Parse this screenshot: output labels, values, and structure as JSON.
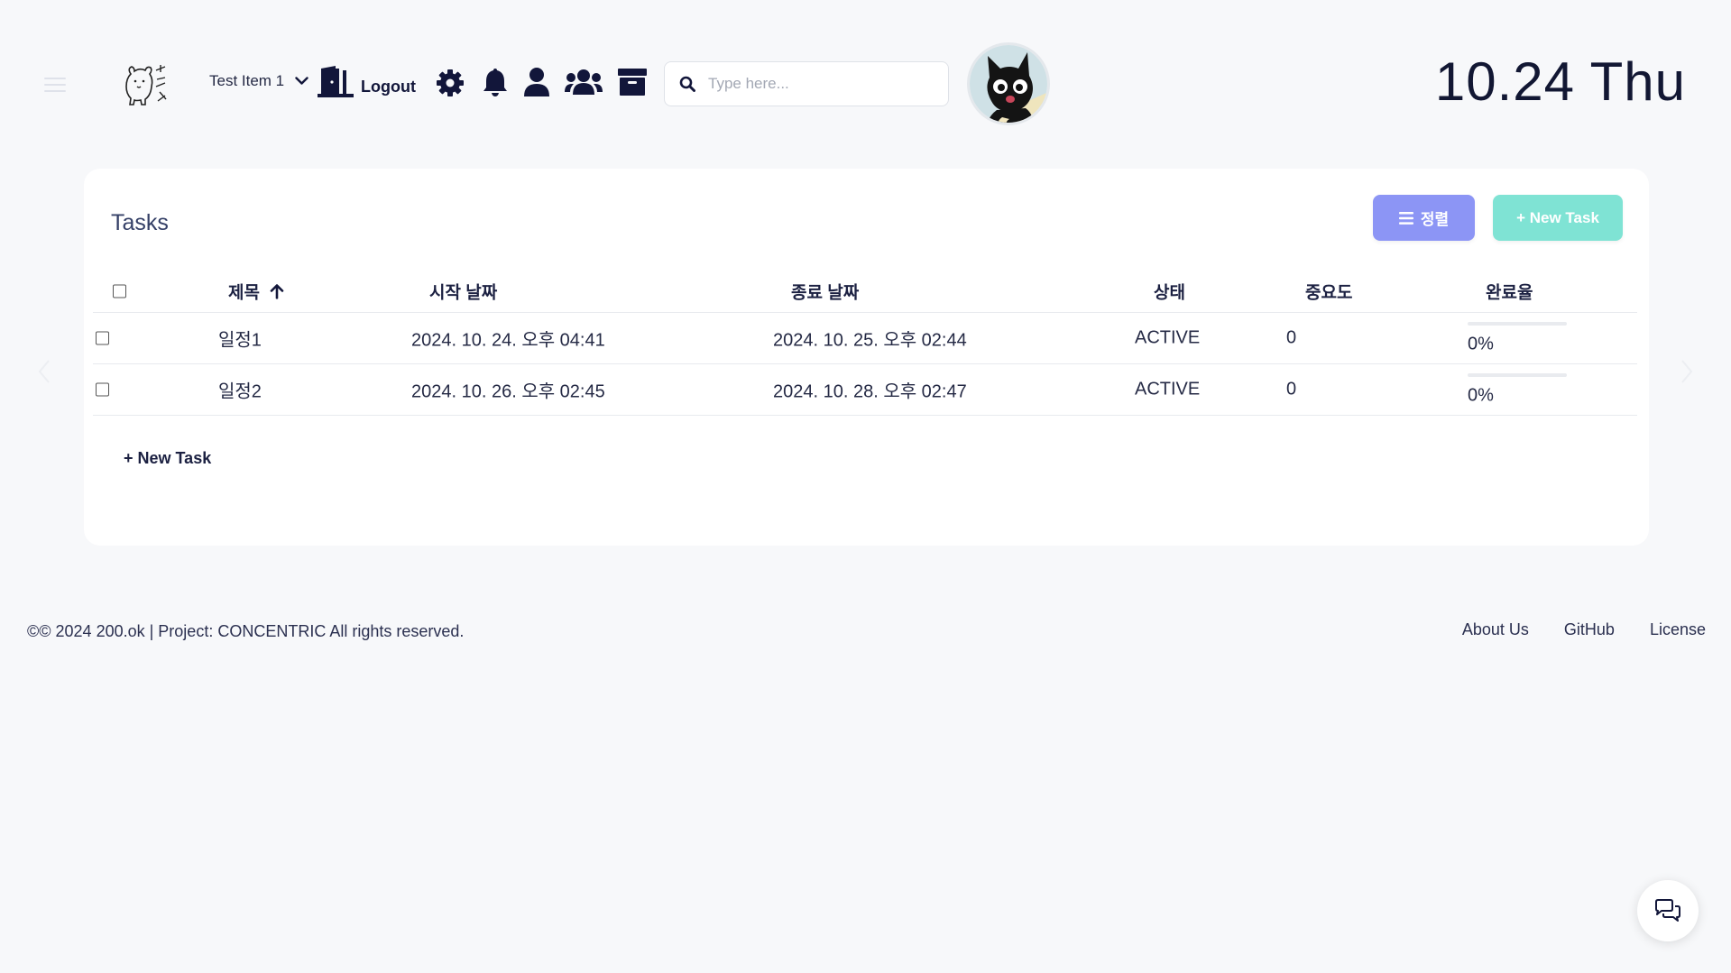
{
  "header": {
    "menu_icon": "hamburger-icon",
    "logo_icon": "bear-logo-icon",
    "item_selector": {
      "label": "Test Item 1",
      "icon": "chevron-down-icon"
    },
    "logout": {
      "label": "Logout",
      "icon": "door-exit-icon"
    },
    "icons": [
      "gear-icon",
      "bell-icon",
      "user-icon",
      "users-icon",
      "archive-icon"
    ],
    "search": {
      "placeholder": "Type here...",
      "value": "",
      "icon": "search-icon"
    },
    "avatar_icon": "black-cat-avatar",
    "date": "10.24  Thu"
  },
  "tasks": {
    "title": "Tasks",
    "sort_button": {
      "label": "정렬",
      "icon": "list-icon"
    },
    "new_task_button": "+ New Task",
    "columns": {
      "title": "제목",
      "start": "시작 날짜",
      "end": "종료 날짜",
      "status": "상태",
      "priority": "중요도",
      "completion": "완료율"
    },
    "sort_icon": "arrow-up-icon",
    "rows": [
      {
        "title": "일정1",
        "start": "2024. 10. 24. 오후 04:41",
        "end": "2024. 10. 25. 오후 02:44",
        "status": "ACTIVE",
        "priority": "0",
        "completion": "0%",
        "progress": 0
      },
      {
        "title": "일정2",
        "start": "2024. 10. 26. 오후 02:45",
        "end": "2024. 10. 28. 오후 02:47",
        "status": "ACTIVE",
        "priority": "0",
        "completion": "0%",
        "progress": 0
      }
    ],
    "new_task_link": "+ New Task"
  },
  "footer": {
    "copyright": "©© 2024 200.ok | Project: CONCENTRIC All rights reserved.",
    "links": [
      "About Us",
      "GitHub",
      "License"
    ]
  },
  "chat_icon": "chat-bubbles-icon",
  "colors": {
    "sort_button": "#8c95f5",
    "new_task_button": "#7fe3d4",
    "text_dark": "#1e2340",
    "background": "#f7f8fa"
  }
}
